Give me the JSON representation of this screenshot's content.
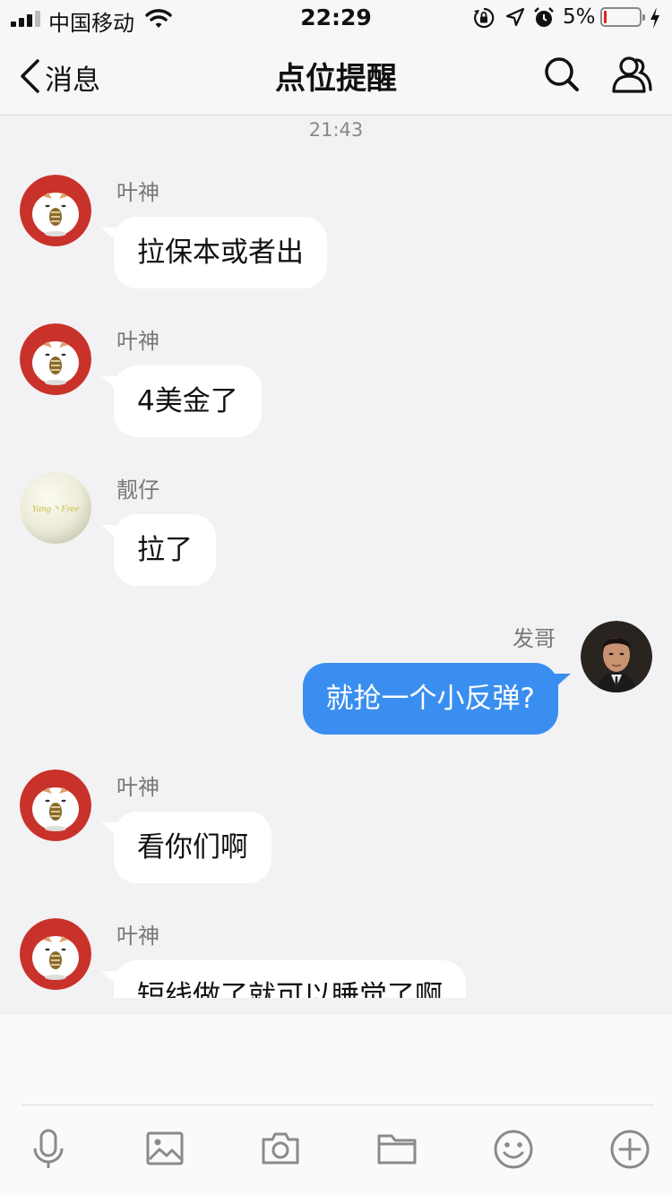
{
  "status_bar": {
    "carrier": "中国移动",
    "time": "22:29",
    "battery_percent": "5%",
    "battery_level": 0.05,
    "battery_color": "#e22222",
    "icons": [
      "signal-icon",
      "wifi-icon",
      "orientation-lock-icon",
      "location-icon",
      "alarm-icon",
      "battery-icon",
      "charging-icon"
    ]
  },
  "nav": {
    "back_label": "消息",
    "title": "点位提醒",
    "icons": [
      "chevron-left-icon",
      "search-icon",
      "group-members-icon"
    ]
  },
  "chat": {
    "time_separator": "21:43",
    "messages": [
      {
        "side": "left",
        "sender": "叶神",
        "text": "拉保本或者出",
        "avatar": "hamster-avatar"
      },
      {
        "side": "left",
        "sender": "叶神",
        "text": "4美金了",
        "avatar": "hamster-avatar"
      },
      {
        "side": "left",
        "sender": "靓仔",
        "text": "拉了",
        "avatar": "moon-avatar",
        "avatar_text": "Yang丶Free"
      },
      {
        "side": "right",
        "sender": "发哥",
        "text": "就抢一个小反弹?",
        "avatar": "man-portrait-avatar"
      },
      {
        "side": "left",
        "sender": "叶神",
        "text": "看你们啊",
        "avatar": "hamster-avatar"
      },
      {
        "side": "left",
        "sender": "叶神",
        "text": "短线做了就可以睡觉了啊",
        "avatar": "hamster-avatar"
      }
    ]
  },
  "colors": {
    "outgoing_bubble": "#3a8ef0",
    "incoming_bubble": "#ffffff",
    "hamster_avatar_bg": "#c9322a",
    "background": "#f2f2f4"
  },
  "toolbar": {
    "icons": [
      "microphone-icon",
      "image-icon",
      "camera-icon",
      "folder-icon",
      "emoji-icon",
      "plus-icon"
    ]
  }
}
